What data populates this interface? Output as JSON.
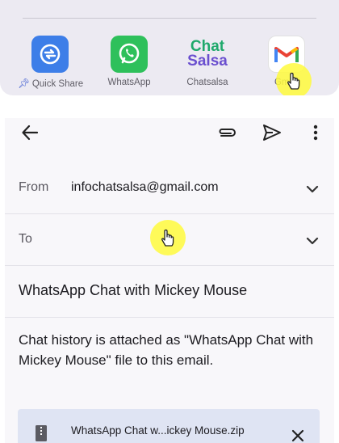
{
  "share_sheet": {
    "apps": [
      {
        "label": "Quick Share",
        "prefix_icon": "pin-icon"
      },
      {
        "label": "WhatsApp"
      },
      {
        "label": "Chatsalsa",
        "logo_line1": "Chat",
        "logo_line2": "Salsa"
      },
      {
        "label": "Gmail"
      }
    ]
  },
  "compose": {
    "from_label": "From",
    "from_value": "infochatsalsa@gmail.com",
    "to_label": "To",
    "subject": "WhatsApp Chat with Mickey Mouse",
    "body": "Chat history is attached as \"WhatsApp Chat with Mickey Mouse\" file to this email.",
    "attachment_name": "WhatsApp Chat w...ickey Mouse.zip"
  },
  "colors": {
    "accent_yellow": "#fffa3c",
    "quick_share_blue": "#3d7ee8",
    "whatsapp_green": "#2ec05b",
    "attachment_bg": "#dfe4f3"
  }
}
